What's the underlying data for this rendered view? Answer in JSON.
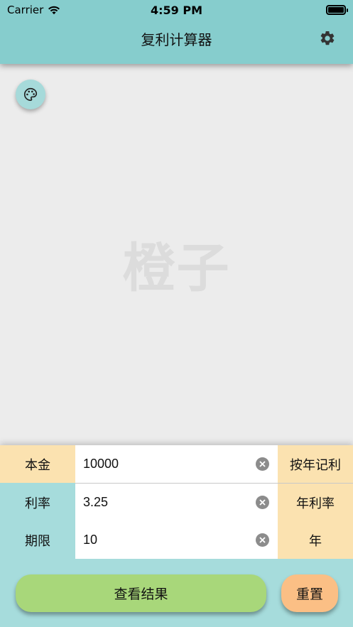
{
  "status_bar": {
    "carrier": "Carrier",
    "time": "4:59 PM"
  },
  "navbar": {
    "title": "复利计算器",
    "settings_icon": "gear-icon",
    "bg_color": "#86cdcd"
  },
  "palette_button": {
    "icon": "palette-icon"
  },
  "watermark": "橙子",
  "form": {
    "rows": [
      {
        "label": "本金",
        "value": "10000",
        "unit": "按年记利"
      },
      {
        "label": "利率",
        "value": "3.25",
        "unit": "年利率"
      },
      {
        "label": "期限",
        "value": "10",
        "unit": "年"
      }
    ]
  },
  "actions": {
    "result_label": "查看结果",
    "reset_label": "重置"
  },
  "colors": {
    "accent": "#86cdcd",
    "principal_label_bg": "#fbe2b0",
    "unit_bg": "#fbe2b0",
    "result_button": "#a8d77a",
    "reset_button": "#fbbf85"
  }
}
